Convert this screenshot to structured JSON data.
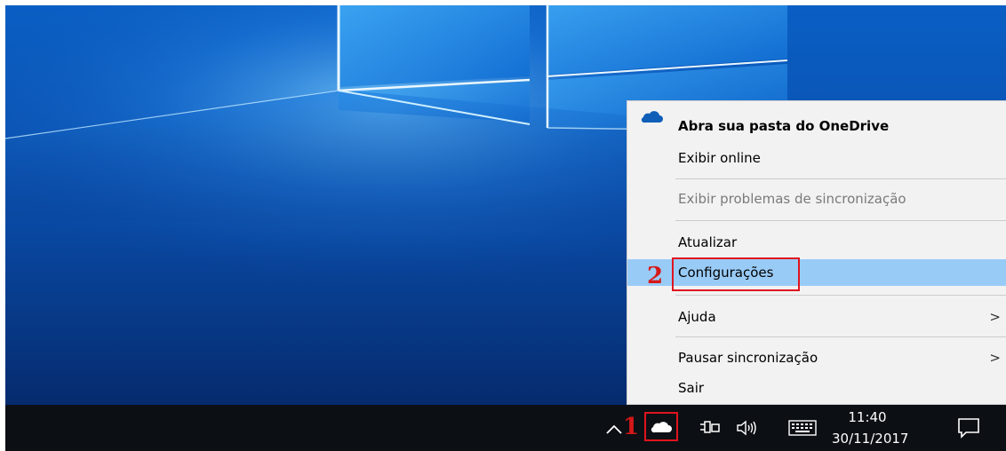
{
  "context_menu": {
    "items": [
      {
        "label": "Abra sua pasta do OneDrive",
        "style": "bold"
      },
      {
        "label": "Exibir online"
      },
      {
        "label": "Exibir problemas de sincronização",
        "style": "disabled"
      },
      {
        "label": "Atualizar"
      },
      {
        "label": "Configurações",
        "style": "highlighted"
      },
      {
        "label": "Ajuda",
        "submenu": ">"
      },
      {
        "label": "Pausar sincronização",
        "submenu": ">"
      },
      {
        "label": "Sair"
      }
    ],
    "highlight_color": "#99cbf7",
    "background_color": "#f2f2f2"
  },
  "annotations": {
    "step_1": "1",
    "step_2": "2",
    "color": "#e0141e"
  },
  "taskbar": {
    "time": "11:40",
    "date": "30/11/2017",
    "tray_icons": [
      "chevron-up-icon",
      "onedrive-cloud-icon",
      "power-plug-icon",
      "speaker-icon",
      "keyboard-icon",
      "action-center-icon"
    ],
    "background_color": "#0c0f14"
  },
  "desktop": {
    "wallpaper": "windows-10-light-window",
    "accent_color": "#0b5fbd"
  }
}
